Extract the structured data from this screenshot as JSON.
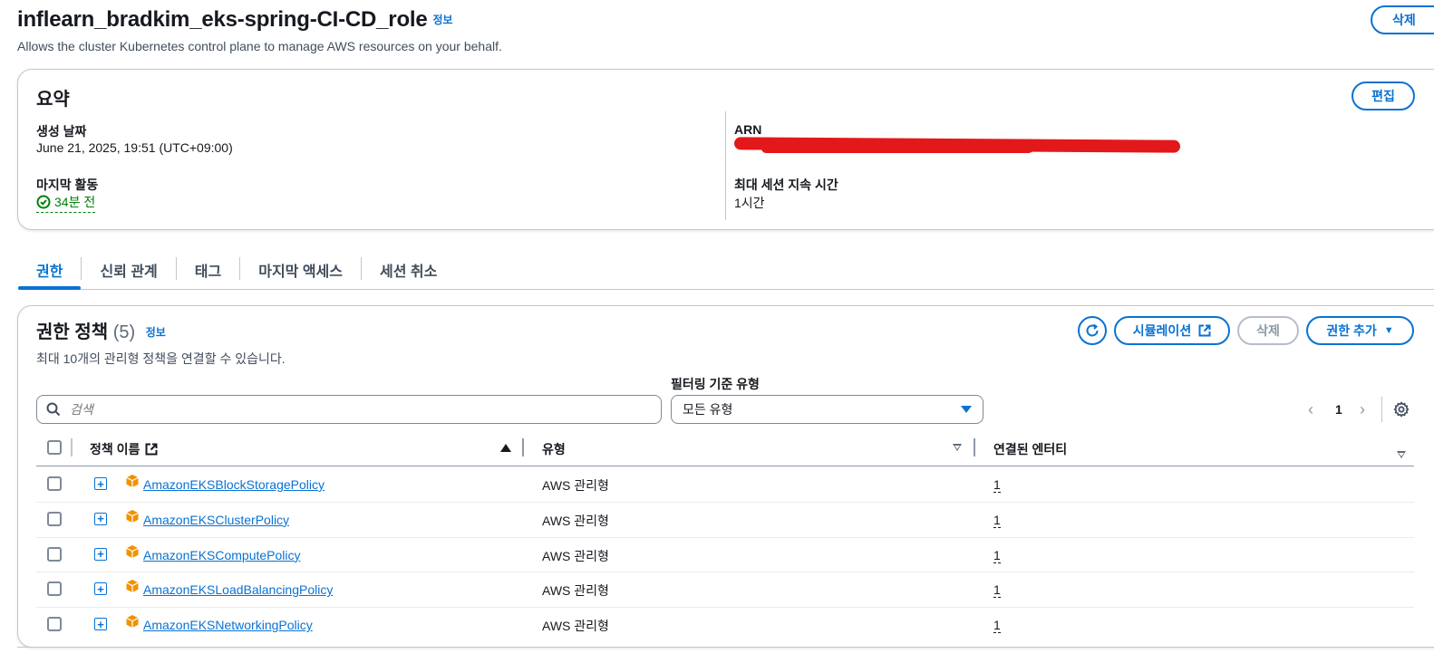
{
  "header": {
    "title": "inflearn_bradkim_eks-spring-CI-CD_role",
    "info_label": "정보",
    "description": "Allows the cluster Kubernetes control plane to manage AWS resources on your behalf.",
    "delete_label": "삭제"
  },
  "summary": {
    "title": "요약",
    "edit_label": "편집",
    "created_key": "생성 날짜",
    "created_value": "June 21, 2025, 19:51 (UTC+09:00)",
    "last_activity_key": "마지막 활동",
    "last_activity_value": "34분 전",
    "arn_key": "ARN",
    "max_session_key": "최대 세션 지속 시간",
    "max_session_value": "1시간"
  },
  "tabs": [
    {
      "label": "권한",
      "active": true
    },
    {
      "label": "신뢰 관계",
      "active": false
    },
    {
      "label": "태그",
      "active": false
    },
    {
      "label": "마지막 액세스",
      "active": false
    },
    {
      "label": "세션 취소",
      "active": false
    }
  ],
  "permissions": {
    "title": "권한 정책",
    "count": "(5)",
    "info_label": "정보",
    "subtitle": "최대 10개의 관리형 정책을 연결할 수 있습니다.",
    "simulation_label": "시뮬레이션",
    "delete_label": "삭제",
    "add_label": "권한 추가",
    "filter_label": "필터링 기준 유형",
    "search_placeholder": "검색",
    "filter_value": "모든 유형",
    "page_number": "1",
    "columns": {
      "name": "정책 이름",
      "type": "유형",
      "entities": "연결된 엔터티"
    },
    "rows": [
      {
        "name": "AmazonEKSBlockStoragePolicy",
        "type": "AWS 관리형",
        "entities": "1"
      },
      {
        "name": "AmazonEKSClusterPolicy",
        "type": "AWS 관리형",
        "entities": "1"
      },
      {
        "name": "AmazonEKSComputePolicy",
        "type": "AWS 관리형",
        "entities": "1"
      },
      {
        "name": "AmazonEKSLoadBalancingPolicy",
        "type": "AWS 관리형",
        "entities": "1"
      },
      {
        "name": "AmazonEKSNetworkingPolicy",
        "type": "AWS 관리형",
        "entities": "1"
      }
    ]
  },
  "colors": {
    "accent": "#0972d3",
    "success": "#037f0c",
    "redaction": "#e3181a",
    "package_icon": "#f29100"
  }
}
